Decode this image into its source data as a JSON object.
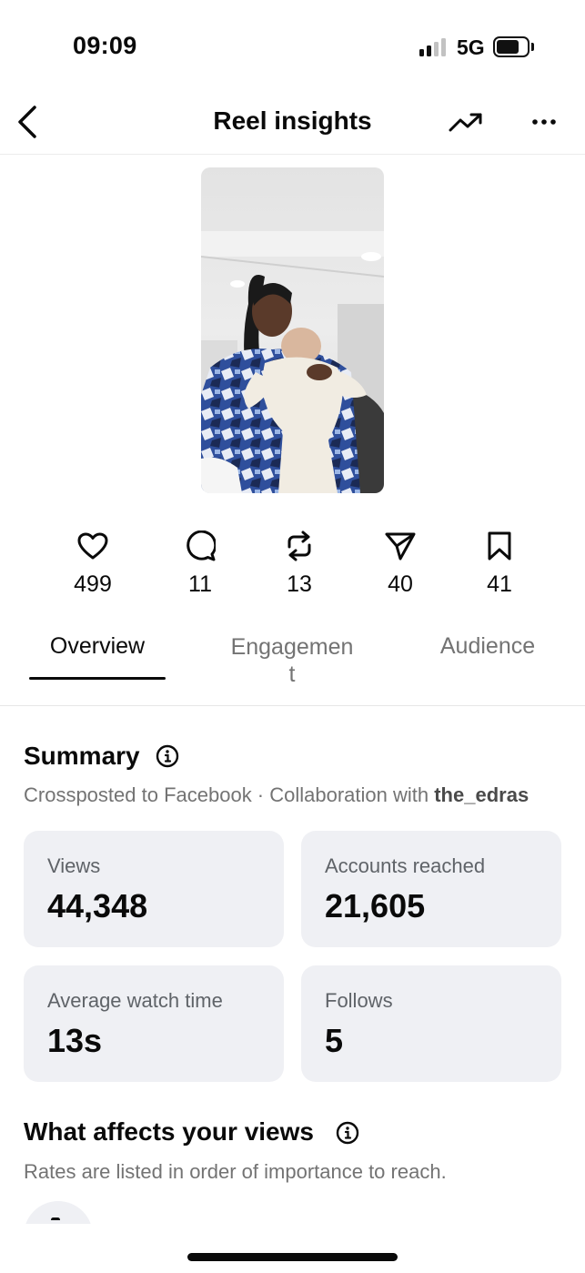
{
  "status_bar": {
    "time": "09:09",
    "network": "5G"
  },
  "header": {
    "title": "Reel insights"
  },
  "reel_counts": [
    {
      "icon": "heart-icon",
      "count": "499"
    },
    {
      "icon": "comment-icon",
      "count": "11"
    },
    {
      "icon": "repost-icon",
      "count": "13"
    },
    {
      "icon": "share-icon",
      "count": "40"
    },
    {
      "icon": "bookmark-icon",
      "count": "41"
    }
  ],
  "tabs": [
    {
      "label": "Overview",
      "active": true
    },
    {
      "label": "Engagemen",
      "label_wrap": "t",
      "active": false
    },
    {
      "label": "Audience",
      "active": false
    }
  ],
  "summary": {
    "title": "Summary",
    "crosspost": "Crossposted to Facebook · Collaboration with ",
    "collaborator": "the_edras",
    "cards": [
      {
        "label": "Views",
        "value": "44,348"
      },
      {
        "label": "Accounts reached",
        "value": "21,605"
      },
      {
        "label": "Average watch time",
        "value": "13s"
      },
      {
        "label": "Follows",
        "value": "5"
      }
    ]
  },
  "affects": {
    "title": "What affects your views",
    "subtitle": "Rates are listed in order of importance to reach."
  },
  "colors": {
    "card_bg": "#eff0f4",
    "muted_text": "#737373",
    "text": "#0a0a0a"
  }
}
